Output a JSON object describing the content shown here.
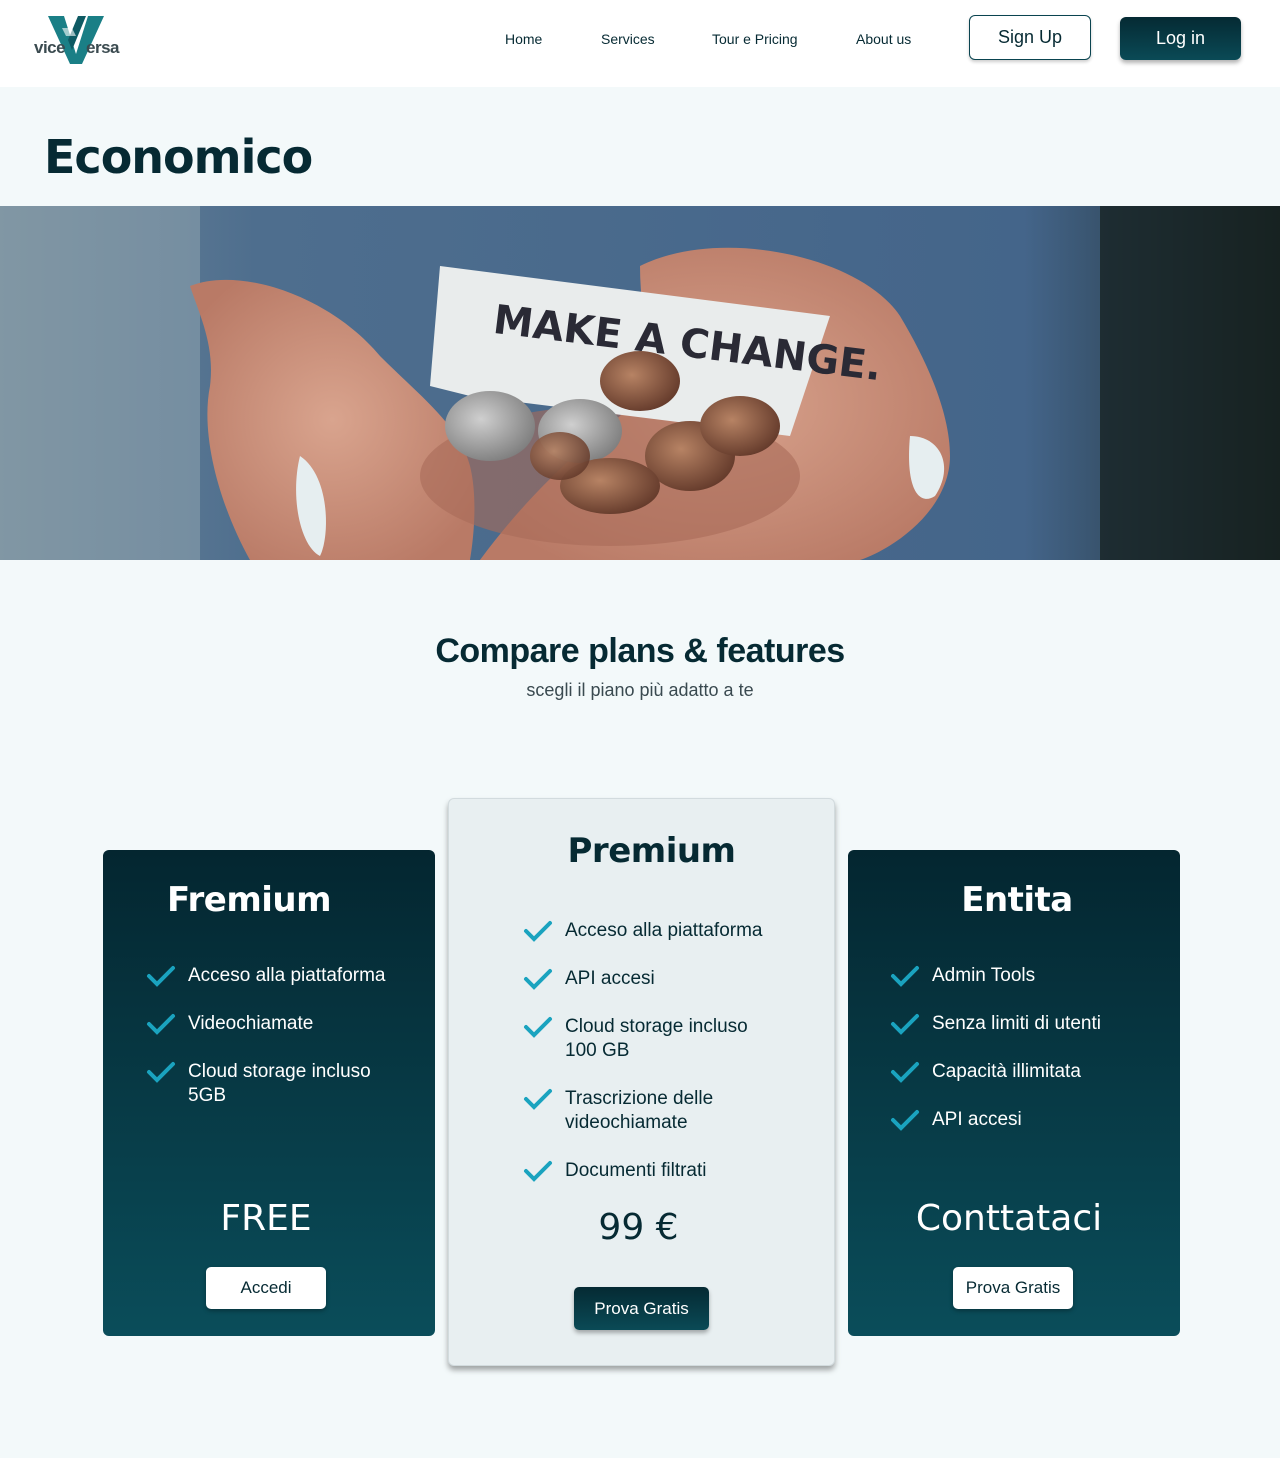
{
  "header": {
    "logo_left": "vice",
    "logo_right": "ersa",
    "nav": [
      "Home",
      "Services",
      "Tour e Pricing",
      "About us"
    ],
    "signup_label": "Sign Up",
    "login_label": "Log in"
  },
  "page_title": "Economico",
  "hero": {
    "note_text": "MAKE A CHANGE."
  },
  "compare": {
    "title": "Compare plans & features",
    "subtitle": "scegli il piano più adatto a te"
  },
  "plans": [
    {
      "name": "Fremium",
      "features": [
        "Acceso alla piattaforma",
        "Videochiamate",
        "Cloud storage incluso 5GB"
      ],
      "price": "FREE",
      "button": "Accedi"
    },
    {
      "name": "Premium",
      "features": [
        "Acceso alla piattaforma",
        "API accesi",
        "Cloud storage incluso 100 GB",
        "Trascrizione delle videochiamate",
        "Documenti filtrati"
      ],
      "price": "99 €",
      "button": "Prova Gratis"
    },
    {
      "name": "Entita",
      "features": [
        "Admin Tools",
        "Senza limiti di utenti",
        "Capacità illimitata",
        "API accesi"
      ],
      "price": "Conttataci",
      "button": "Prova Gratis"
    }
  ],
  "colors": {
    "brand_dark": "#062a33",
    "brand_teal": "#0a4d5a",
    "check": "#1aa3bf",
    "page_bg": "#f3f9fa"
  }
}
